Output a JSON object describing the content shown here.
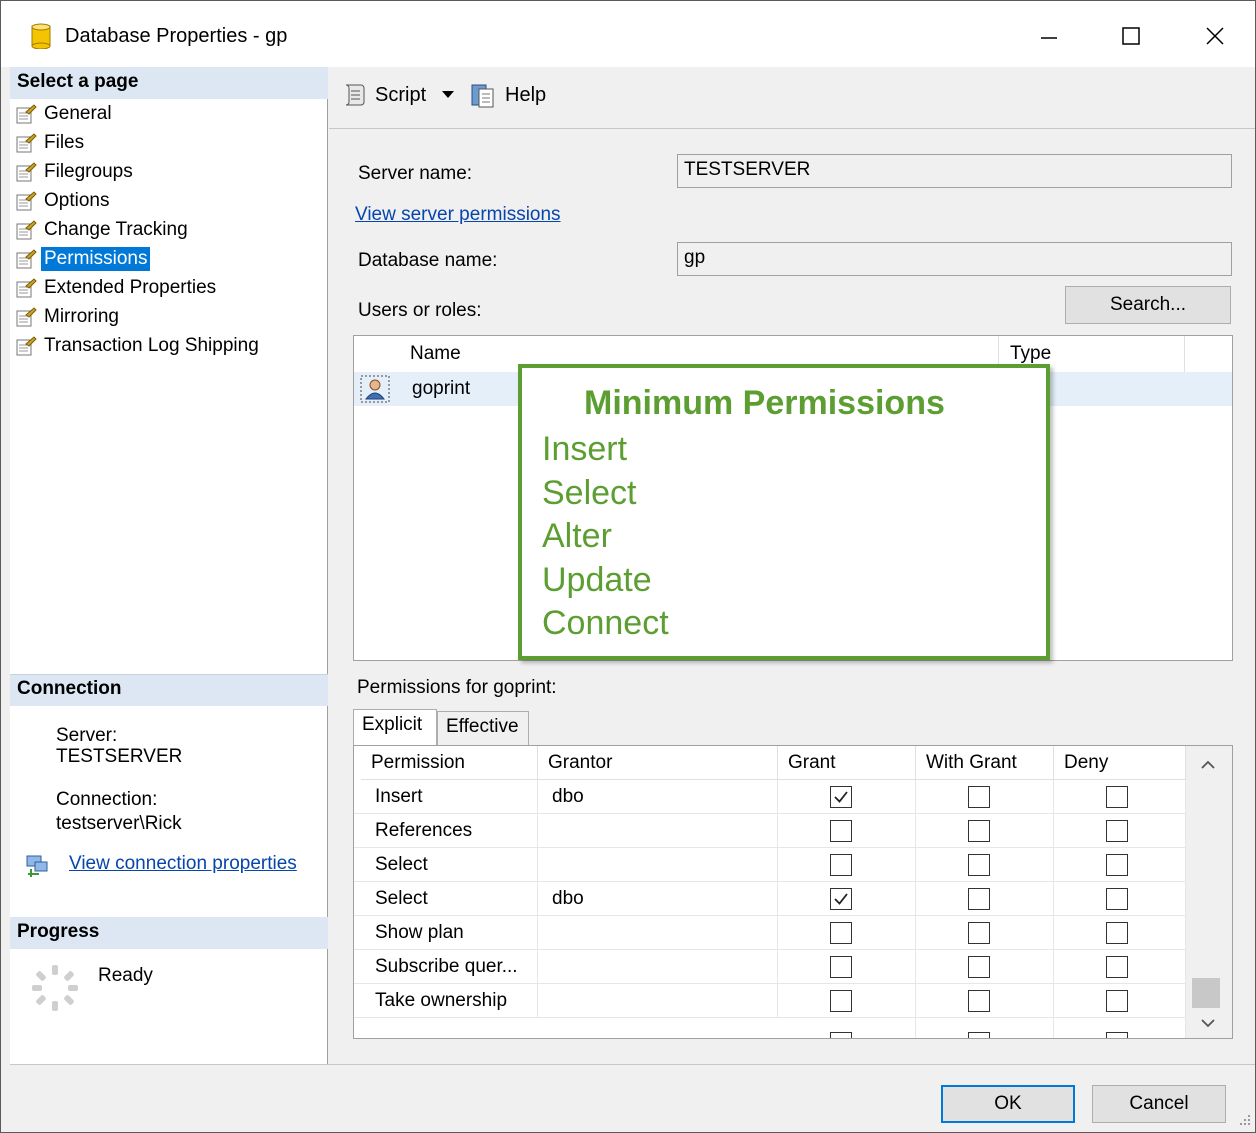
{
  "window": {
    "title": "Database Properties - gp"
  },
  "left_pane": {
    "select_page_header": "Select a page",
    "pages": [
      {
        "label": "General"
      },
      {
        "label": "Files"
      },
      {
        "label": "Filegroups"
      },
      {
        "label": "Options"
      },
      {
        "label": "Change Tracking"
      },
      {
        "label": "Permissions",
        "selected": true
      },
      {
        "label": "Extended Properties"
      },
      {
        "label": "Mirroring"
      },
      {
        "label": "Transaction Log Shipping"
      }
    ],
    "connection_header": "Connection",
    "server_label": "Server:",
    "server_value": "TESTSERVER",
    "connection_label": "Connection:",
    "connection_value": "testserver\\Rick",
    "view_connection_link": "View connection properties",
    "progress_header": "Progress",
    "progress_status": "Ready"
  },
  "toolbar": {
    "script_label": "Script",
    "help_label": "Help"
  },
  "form": {
    "server_name_label": "Server name:",
    "server_name_value": "TESTSERVER",
    "view_server_permissions_link": "View server permissions",
    "database_name_label": "Database name:",
    "database_name_value": "gp",
    "users_roles_label": "Users or roles:",
    "search_button": "Search...",
    "users_columns": {
      "name": "Name",
      "type": "Type"
    },
    "users": [
      {
        "name": "goprint"
      }
    ],
    "permissions_for_label": "Permissions for goprint:"
  },
  "callout": {
    "title": "Minimum Permissions",
    "items": [
      "Insert",
      "Select",
      "Alter",
      "Update",
      "Connect"
    ]
  },
  "tabs": [
    {
      "label": "Explicit",
      "active": true
    },
    {
      "label": "Effective",
      "active": false
    }
  ],
  "permissions_grid": {
    "columns": [
      "Permission",
      "Grantor",
      "Grant",
      "With Grant",
      "Deny"
    ],
    "rows": [
      {
        "permission": "Insert",
        "grantor": "dbo",
        "grant": true,
        "with_grant": false,
        "deny": false
      },
      {
        "permission": "References",
        "grantor": "",
        "grant": false,
        "with_grant": false,
        "deny": false
      },
      {
        "permission": "Select",
        "grantor": "",
        "grant": false,
        "with_grant": false,
        "deny": false
      },
      {
        "permission": "Select",
        "grantor": "dbo",
        "grant": true,
        "with_grant": false,
        "deny": false
      },
      {
        "permission": "Show plan",
        "grantor": "",
        "grant": false,
        "with_grant": false,
        "deny": false
      },
      {
        "permission": "Subscribe quer...",
        "grantor": "",
        "grant": false,
        "with_grant": false,
        "deny": false
      },
      {
        "permission": "Take ownership",
        "grantor": "",
        "grant": false,
        "with_grant": false,
        "deny": false
      }
    ]
  },
  "dialog_buttons": {
    "ok": "OK",
    "cancel": "Cancel"
  },
  "colors": {
    "selection": "#0078d7",
    "section_header": "#dde7f3",
    "callout_green": "#5c9e31",
    "link": "#0645ad"
  }
}
